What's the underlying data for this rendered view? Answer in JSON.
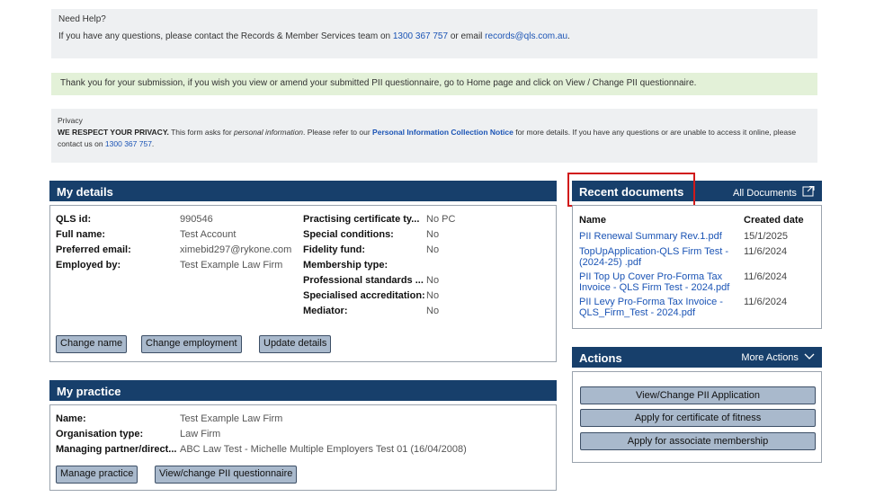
{
  "help": {
    "title": "Need Help?",
    "text_before": "If you have any questions, please contact the Records & Member Services team on ",
    "phone": "1300 367 757",
    "text_mid": " or email ",
    "email": "records@qls.com.au",
    "text_after": "."
  },
  "thanks": {
    "text": "Thank you for your submission, if you wish you view or amend your submitted PII questionnaire, go to Home page and click on View / Change PII questionnaire."
  },
  "privacy": {
    "title": "Privacy",
    "bold": "WE RESPECT YOUR PRIVACY.",
    "text1": " This form asks for ",
    "italic": "personal information",
    "text2": ". Please refer to our ",
    "link": "Personal Information Collection Notice",
    "text3": " for more details. If you have any questions or are unable to access it online, please contact us on ",
    "phone": "1300 367 757",
    "text4": "."
  },
  "my_details": {
    "title": "My details",
    "left": [
      {
        "label": "QLS id:",
        "value": "990546"
      },
      {
        "label": "Full name:",
        "value": "Test Account"
      },
      {
        "label": "Preferred email:",
        "value": "ximebid297@rykone.com"
      },
      {
        "label": "Employed by:",
        "value": "Test Example Law Firm"
      }
    ],
    "right": [
      {
        "label": "Practising certificate ty...",
        "value": "No PC"
      },
      {
        "label": "Special conditions:",
        "value": "No"
      },
      {
        "label": "Fidelity fund:",
        "value": "No"
      },
      {
        "label": "Membership type:",
        "value": ""
      },
      {
        "label": "Professional standards ...",
        "value": "No"
      },
      {
        "label": "Specialised accreditation:",
        "value": "No"
      },
      {
        "label": "Mediator:",
        "value": "No"
      }
    ],
    "buttons": {
      "change_name": "Change name",
      "change_employment": "Change employment",
      "update_details": "Update details"
    }
  },
  "my_practice": {
    "title": "My practice",
    "rows": [
      {
        "label": "Name:",
        "value": "Test Example Law Firm"
      },
      {
        "label": "Organisation type:",
        "value": "Law Firm"
      },
      {
        "label": "Managing partner/direct...",
        "value": "ABC Law Test - Michelle Multiple Employers Test 01 (16/04/2008)"
      }
    ],
    "buttons": {
      "manage_practice": "Manage practice",
      "view_change_pii": "View/change PII questionnaire"
    }
  },
  "recent_documents": {
    "title": "Recent documents",
    "all_documents": "All Documents",
    "headers": {
      "name": "Name",
      "date": "Created date"
    },
    "rows": [
      {
        "name": "PII Renewal Summary Rev.1.pdf",
        "date": "15/1/2025"
      },
      {
        "name": "TopUpApplication-QLS Firm Test - (2024-25) .pdf",
        "date": "11/6/2024"
      },
      {
        "name": "PII Top Up Cover Pro-Forma Tax Invoice - QLS Firm Test - 2024.pdf",
        "date": "11/6/2024"
      },
      {
        "name": "PII Levy Pro-Forma Tax Invoice - QLS_Firm_Test - 2024.pdf",
        "date": "11/6/2024"
      }
    ]
  },
  "actions": {
    "title": "Actions",
    "more_actions": "More Actions",
    "items": [
      "View/Change PII Application",
      "Apply for certificate of fitness",
      "Apply for associate membership"
    ]
  }
}
